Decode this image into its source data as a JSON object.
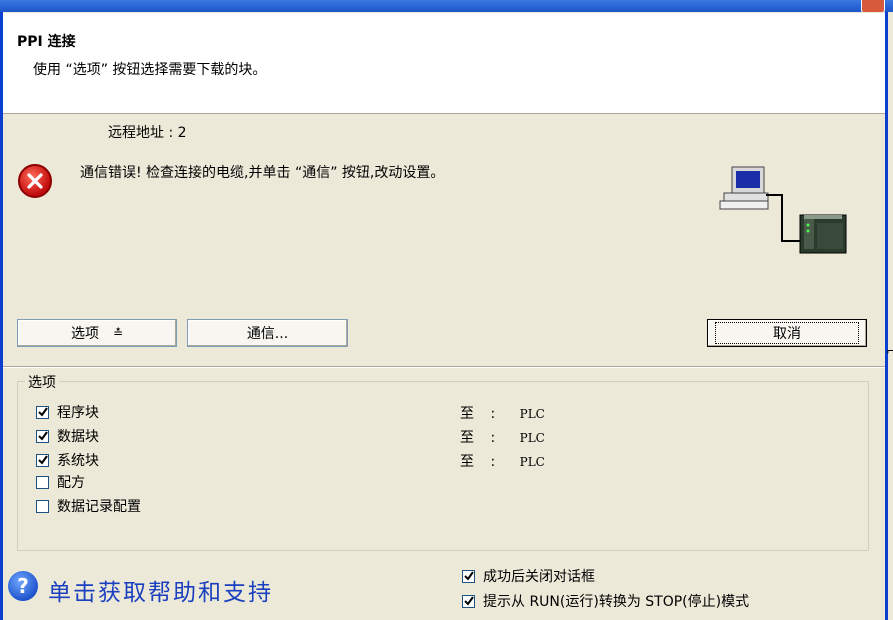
{
  "header": {
    "title": "PPI 连接",
    "subtitle": "使用 “选项” 按钮选择需要下载的块。"
  },
  "remote_address": "远程地址 :  2",
  "error_message": "通信错误!  检查连接的电缆,并单击 “通信” 按钮,改动设置。",
  "buttons": {
    "options_label": "选项",
    "options_arrow": "≛",
    "comm_label": "通信...",
    "cancel_label": "取消"
  },
  "options_group": {
    "label": "选项",
    "items": [
      {
        "label": "程序块",
        "checked": true,
        "target_to": "至",
        "target_sep": ":",
        "target": "PLC"
      },
      {
        "label": "数据块",
        "checked": true,
        "target_to": "至",
        "target_sep": ":",
        "target": "PLC"
      },
      {
        "label": "系统块",
        "checked": true,
        "target_to": "至",
        "target_sep": ":",
        "target": "PLC"
      },
      {
        "label": "配方",
        "checked": false
      },
      {
        "label": "数据记录配置",
        "checked": false
      }
    ]
  },
  "footer": {
    "help_text": "单击获取帮助和支持",
    "close_on_success": {
      "label": "成功后关闭对话框",
      "checked": true
    },
    "prompt_run_stop": {
      "label": "提示从 RUN(运行)转换为 STOP(停止)模式",
      "checked": true
    }
  },
  "icons": {
    "error": "error-icon",
    "help": "help-icon",
    "network": "pc-to-plc-icon"
  },
  "colors": {
    "dialog_bg": "#ece9d8",
    "title_bar": "#1d55c9",
    "error_red": "#c00c0c",
    "help_link": "#1a3fbf"
  }
}
